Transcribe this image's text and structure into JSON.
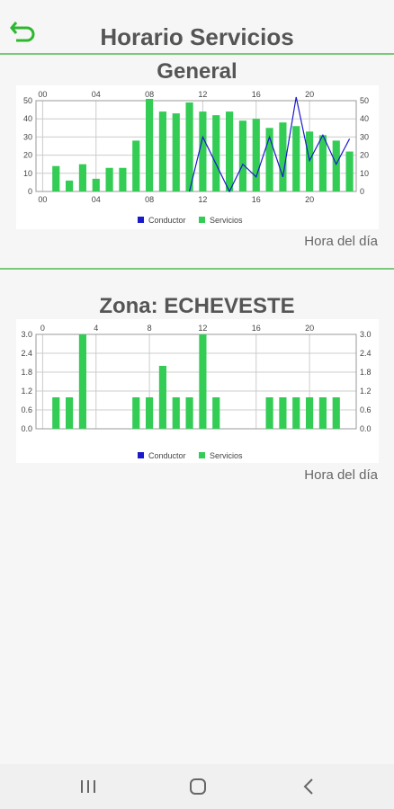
{
  "header": {
    "title": "Horario Servicios",
    "back_icon": "return-arrow-icon"
  },
  "colors": {
    "accent": "#2db82d",
    "bar": "#33cc55",
    "line": "#1a1acc"
  },
  "sections": [
    {
      "title": "General",
      "x_axis_label": "Hora del día"
    },
    {
      "title": "Zona: ECHEVESTE",
      "x_axis_label": "Hora del día"
    }
  ],
  "chart_data": [
    {
      "type": "bar",
      "top_ticks": [
        "00",
        "04",
        "08",
        "12",
        "16",
        "20"
      ],
      "bottom_ticks": [
        "00",
        "04",
        "08",
        "12",
        "16",
        "20"
      ],
      "x": [
        1,
        2,
        3,
        4,
        5,
        6,
        7,
        8,
        9,
        10,
        11,
        12,
        13,
        14,
        15,
        16,
        17,
        18,
        19,
        20,
        21,
        22,
        23
      ],
      "ylim": [
        0,
        50
      ],
      "y_ticks_left": [
        "0",
        "10",
        "20",
        "30",
        "40",
        "50"
      ],
      "y_ticks_right": [
        "0",
        "10",
        "20",
        "30",
        "40",
        "50"
      ],
      "legend": [
        {
          "label": "Conductor",
          "color": "#1a1acc"
        },
        {
          "label": "Servicios",
          "color": "#33cc55"
        }
      ],
      "series": [
        {
          "name": "Servicios",
          "type": "bar",
          "values": [
            14,
            6,
            15,
            7,
            13,
            13,
            28,
            51,
            44,
            43,
            49,
            44,
            42,
            44,
            39,
            40,
            35,
            38,
            36,
            33,
            31,
            28,
            22
          ]
        },
        {
          "name": "Conductor",
          "type": "line",
          "points": [
            [
              11,
              0
            ],
            [
              12,
              30
            ],
            [
              13,
              15
            ],
            [
              14,
              0
            ],
            [
              15,
              15
            ],
            [
              16,
              8
            ],
            [
              17,
              30
            ],
            [
              18,
              8
            ],
            [
              19,
              52
            ],
            [
              20,
              17
            ],
            [
              21,
              31
            ],
            [
              22,
              15
            ],
            [
              23,
              29
            ]
          ]
        }
      ]
    },
    {
      "type": "bar",
      "top_ticks": [
        "0",
        "4",
        "8",
        "12",
        "16",
        "20"
      ],
      "x": [
        1,
        2,
        3,
        7,
        8,
        9,
        10,
        11,
        12,
        13,
        17,
        18,
        19,
        20,
        21,
        22
      ],
      "ylim": [
        0,
        3
      ],
      "y_ticks_left": [
        "0.0",
        "0.6",
        "1.2",
        "1.8",
        "2.4",
        "3.0"
      ],
      "y_ticks_right": [
        "0.0",
        "0.6",
        "1.2",
        "1.8",
        "2.4",
        "3.0"
      ],
      "legend": [
        {
          "label": "Conductor",
          "color": "#1a1acc"
        },
        {
          "label": "Servicios",
          "color": "#33cc55"
        }
      ],
      "series": [
        {
          "name": "Servicios",
          "type": "bar",
          "values": [
            1,
            1,
            3,
            1,
            1,
            2,
            1,
            1,
            3,
            1,
            1,
            1,
            1,
            1,
            1,
            1
          ]
        }
      ]
    }
  ],
  "navbar": {
    "items": [
      "recent-apps-icon",
      "home-icon",
      "back-icon"
    ]
  }
}
